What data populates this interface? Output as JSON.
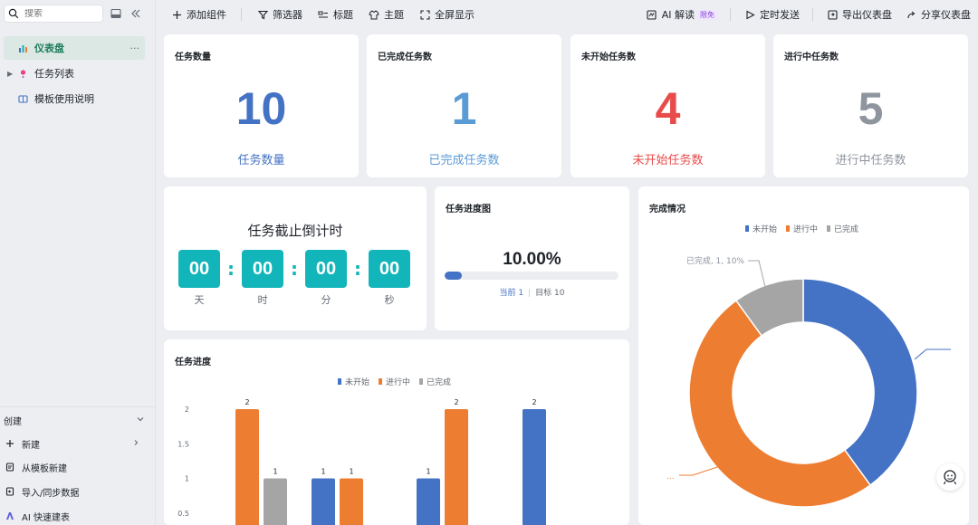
{
  "sidebar": {
    "search_placeholder": "搜索",
    "items": [
      {
        "label": "仪表盘",
        "more": "···"
      },
      {
        "label": "任务列表"
      },
      {
        "label": "模板使用说明"
      }
    ],
    "create_section": {
      "title": "创建",
      "items": [
        {
          "label": "新建"
        },
        {
          "label": "从模板新建"
        },
        {
          "label": "导入/同步数据"
        },
        {
          "label": "AI 快速建表"
        }
      ]
    }
  },
  "toolbar": {
    "left": [
      {
        "label": "添加组件",
        "icon": "plus-icon"
      },
      {
        "label": "筛选器",
        "icon": "filter-icon"
      },
      {
        "label": "标题",
        "icon": "title-icon"
      },
      {
        "label": "主题",
        "icon": "shirt-icon"
      },
      {
        "label": "全屏显示",
        "icon": "fullscreen-icon"
      }
    ],
    "right": [
      {
        "label": "AI 解读",
        "badge": "限免",
        "icon": "ai-icon"
      },
      {
        "label": "定时发送",
        "icon": "send-icon"
      },
      {
        "label": "导出仪表盘",
        "icon": "export-icon"
      },
      {
        "label": "分享仪表盘",
        "icon": "share-icon"
      }
    ]
  },
  "metrics": [
    {
      "title": "任务数量",
      "value": "10",
      "label": "任务数量",
      "color": "#4472c4"
    },
    {
      "title": "已完成任务数",
      "value": "1",
      "label": "已完成任务数",
      "color": "#5b9bd5"
    },
    {
      "title": "未开始任务数",
      "value": "4",
      "label": "未开始任务数",
      "color": "#e84b4b"
    },
    {
      "title": "进行中任务数",
      "value": "5",
      "label": "进行中任务数",
      "color": "#8f959e"
    }
  ],
  "countdown": {
    "title": "任务截止倒计时",
    "units": [
      {
        "value": "00",
        "label": "天"
      },
      {
        "value": "00",
        "label": "时"
      },
      {
        "value": "00",
        "label": "分"
      },
      {
        "value": "00",
        "label": "秒"
      }
    ],
    "separator": ":"
  },
  "progress": {
    "title": "任务进度图",
    "percent_text": "10.00%",
    "fraction": 0.1,
    "current_label": "当前 1",
    "target_label": "目标 10"
  },
  "colors": {
    "not_started": "#4472c4",
    "in_progress": "#ed7d31",
    "done": "#a5a5a5",
    "accent_green": "#1b7c5c",
    "countdown": "#12b5b9"
  },
  "charts": {
    "task_progress": {
      "title": "任务进度",
      "legend": [
        "未开始",
        "进行中",
        "已完成"
      ]
    },
    "completion": {
      "title": "完成情况",
      "legend": [
        "未开始",
        "进行中",
        "已完成"
      ],
      "visible_label": "已完成, 1, 10%",
      "cut_label": "..."
    }
  },
  "chart_data": [
    {
      "type": "bar",
      "title": "任务进度",
      "categories": [
        "",
        "",
        "",
        "",
        ""
      ],
      "series": [
        {
          "name": "未开始",
          "values": [
            0,
            1,
            1,
            2
          ]
        },
        {
          "name": "进行中",
          "values": [
            2,
            1,
            2,
            0
          ]
        },
        {
          "name": "已完成",
          "values": [
            1,
            0,
            0,
            0
          ]
        }
      ],
      "y_ticks": [
        "0.5",
        "1",
        "1.5",
        "2"
      ],
      "ylim": [
        0,
        2
      ],
      "legend_position": "top"
    },
    {
      "type": "pie",
      "title": "完成情况",
      "labels": [
        "未开始",
        "进行中",
        "已完成"
      ],
      "values": [
        4,
        5,
        1
      ],
      "donut": true,
      "legend_position": "top"
    }
  ]
}
